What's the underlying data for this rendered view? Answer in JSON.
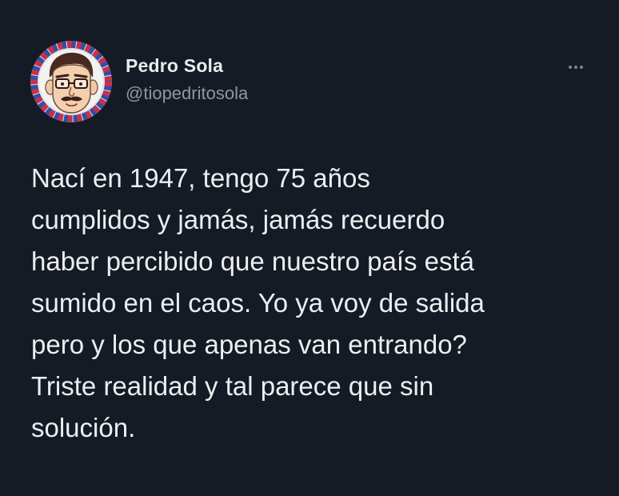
{
  "author": {
    "display_name": "Pedro Sola",
    "handle": "@tiopedritosola",
    "avatar_icon": "caricature-avatar"
  },
  "menu": {
    "icon": "more-options-icon"
  },
  "tweet": {
    "lines": [
      "Nací en 1947, tengo 75 años",
      "cumplidos y jamás, jamás recuerdo",
      "haber percibido que nuestro país está",
      "sumido en el caos. Yo ya voy de salida",
      "pero y los que apenas van entrando?",
      "Triste realidad y tal parece que sin",
      "solución."
    ]
  },
  "colors": {
    "background": "#151b24",
    "text": "#eceef0",
    "muted": "#8f979f"
  }
}
